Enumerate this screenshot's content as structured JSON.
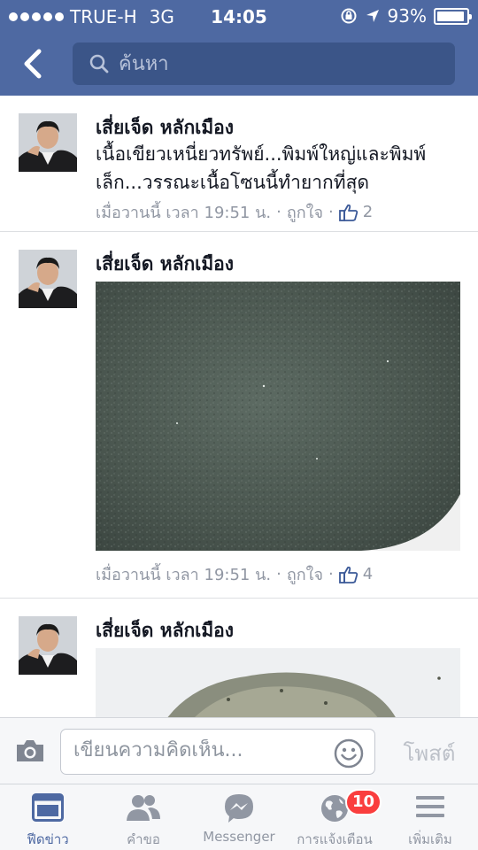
{
  "status_bar": {
    "carrier": "TRUE-H",
    "network": "3G",
    "time": "14:05",
    "battery": "93%",
    "battery_level": 0.93
  },
  "nav": {
    "back_icon": "chevron-left-icon",
    "search_placeholder": "ค้นหา"
  },
  "feed": {
    "items": [
      {
        "author": "เสี่ยเจ็ด หลักเมือง",
        "text": "เนื้อเขียวเหนี่ยวทรัพย์...พิมพ์ใหญ่และพิมพ์เล็ก...วรรณะเนื้อโซนนี้ทำยากที่สุด",
        "timestamp": "เมื่อวานนี้ เวลา 19:51 น.",
        "separator": "·",
        "like_label": "ถูกใจ",
        "like_count": "2"
      },
      {
        "author": "เสี่ยเจ็ด หลักเมือง",
        "image": "green-sand-powder-photo",
        "timestamp": "เมื่อวานนี้ เวลา 19:51 น.",
        "separator": "·",
        "like_label": "ถูกใจ",
        "like_count": "4"
      },
      {
        "author": "เสี่ยเจ็ด หลักเมือง",
        "image": "herb-powder-pile-photo"
      }
    ]
  },
  "comment_bar": {
    "placeholder": "เขียนความคิดเห็น...",
    "post_label": "โพสต์"
  },
  "tab_bar": {
    "tabs": [
      {
        "label": "ฟีดข่าว",
        "icon": "news-feed-icon",
        "active": true
      },
      {
        "label": "คำขอ",
        "icon": "friend-requests-icon",
        "active": false
      },
      {
        "label": "Messenger",
        "icon": "messenger-icon",
        "active": false
      },
      {
        "label": "การแจ้งเตือน",
        "icon": "globe-notifications-icon",
        "active": false,
        "badge": "10"
      },
      {
        "label": "เพิ่มเติม",
        "icon": "menu-icon",
        "active": false
      }
    ]
  },
  "colors": {
    "brand": "#4e69a2",
    "link_blue": "#3b5998",
    "badge_red": "#fa3e3e"
  }
}
